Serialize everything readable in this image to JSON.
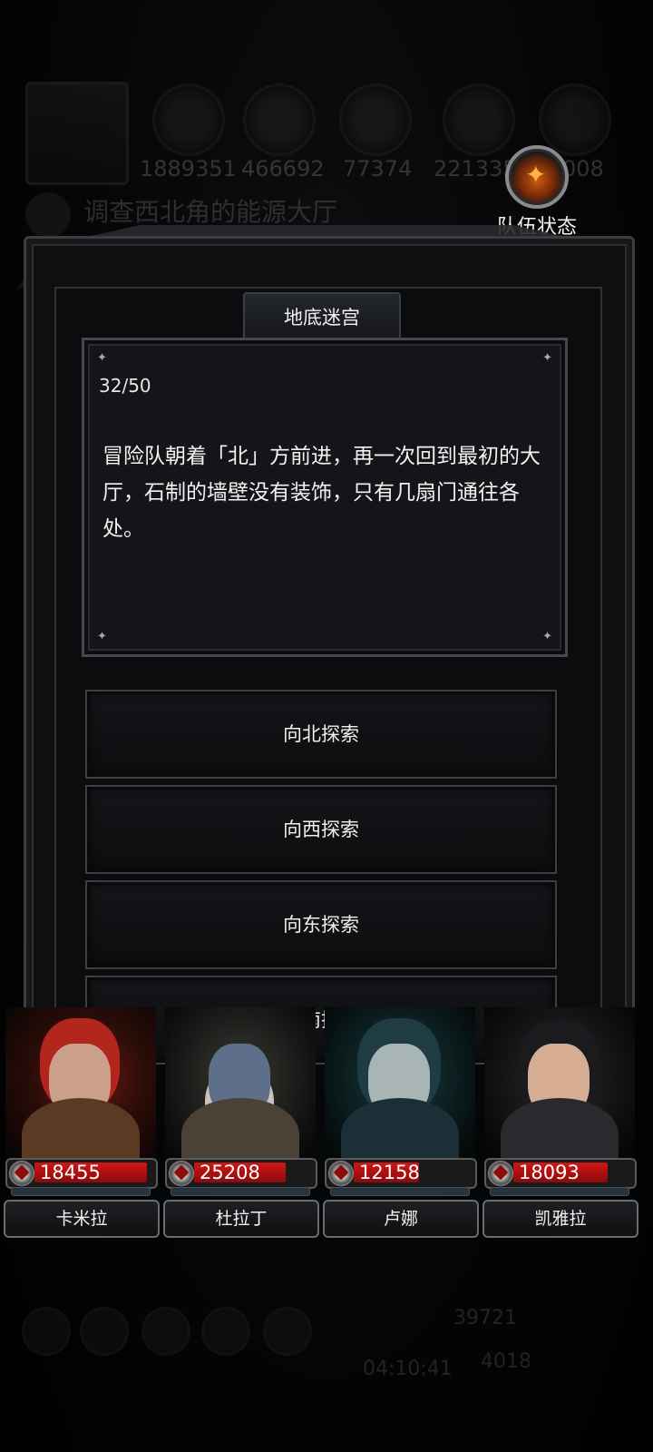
{
  "background": {
    "resources": [
      "1889351",
      "466692",
      "77374",
      "221335",
      "008"
    ],
    "quest_text": "调查西北角的能源大厅",
    "bottom_counter_1": "39721",
    "bottom_counter_2": "4018",
    "timer": "04:10:41"
  },
  "team_status": {
    "label": "队伍状态",
    "icon": "flame-icon"
  },
  "dungeon": {
    "title": "地底迷宫",
    "progress": "32/50",
    "story_text": "冒险队朝着「北」方前进，再一次回到最初的大厅，石制的墙壁没有装饰，只有几扇门通往各处。"
  },
  "options": [
    {
      "label": "向北探索"
    },
    {
      "label": "向西探索"
    },
    {
      "label": "向东探索"
    },
    {
      "label": "向南探索"
    }
  ],
  "heroes": [
    {
      "name": "卡米拉",
      "hp": "18455",
      "hp_fraction": 0.95
    },
    {
      "name": "杜拉丁",
      "hp": "25208",
      "hp_fraction": 0.78
    },
    {
      "name": "卢娜",
      "hp": "12158",
      "hp_fraction": 0.55
    },
    {
      "name": "凯雅拉",
      "hp": "18093",
      "hp_fraction": 0.8
    }
  ],
  "colors": {
    "hp_red": "#d01616",
    "panel_border": "#3c3e43",
    "text_light": "#f0f0f0"
  }
}
